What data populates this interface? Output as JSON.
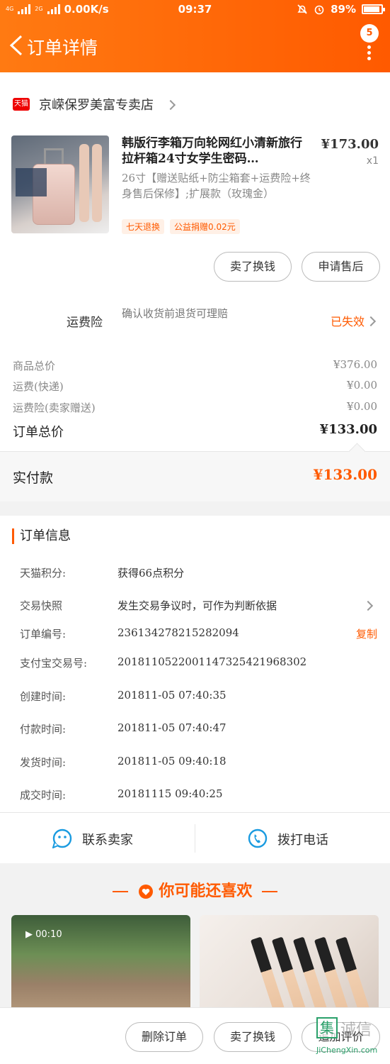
{
  "status_bar": {
    "network": "4G",
    "network2": "2G",
    "speed": "0.00K/s",
    "time": "09:37",
    "battery": "89%"
  },
  "header": {
    "title": "订单详情",
    "badge_count": "5"
  },
  "shop": {
    "badge": "天猫",
    "name": "京嵘保罗美富专卖店"
  },
  "product": {
    "title": "韩版行李箱万向轮网红小清新旅行拉杆箱24寸女学生密码…",
    "sku": "26寸【赠送贴纸+防尘箱套+运费险+终身售后保修】;扩展款（玫瑰金）",
    "tags": [
      "七天退换",
      "公益捐赠0.02元"
    ],
    "price": "¥173.00",
    "qty": "x1"
  },
  "actions": {
    "sell_for_cash": "卖了换钱",
    "after_sale": "申请售后"
  },
  "insurance": {
    "label": "运费险",
    "desc": "确认收货前退货可理赔",
    "status": "已失效"
  },
  "summary": {
    "goods_total_label": "商品总价",
    "goods_total_value": "¥376.00",
    "shipping_label": "运费(快递)",
    "shipping_value": "¥0.00",
    "insurance_label": "运费险(卖家赠送)",
    "insurance_value": "¥0.00",
    "order_total_label": "订单总价",
    "order_total_value": "¥133.00",
    "paid_label": "实付款",
    "paid_value": "¥133.00"
  },
  "order_info": {
    "heading": "订单信息",
    "rows": [
      {
        "key": "天猫积分:",
        "value": "获得66点积分"
      },
      {
        "key": "交易快照",
        "value": "发生交易争议时，可作为判断依据"
      },
      {
        "key": "订单编号:",
        "value": "236134278215282094"
      },
      {
        "key": "支付宝交易号:",
        "value": "2018110522001147325421968302"
      },
      {
        "key": "创建时间:",
        "value": "201811-05 07:40:35"
      },
      {
        "key": "付款时间:",
        "value": "201811-05 07:40:47"
      },
      {
        "key": "发货时间:",
        "value": "201811-05 09:40:18"
      },
      {
        "key": "成交时间:",
        "value": "20181115 09:40:25"
      }
    ],
    "copy_label": "复制"
  },
  "contact": {
    "seller": "联系卖家",
    "call": "拨打电话"
  },
  "recommend": {
    "title": "你可能还喜欢",
    "video_time": "00:10"
  },
  "bottom": {
    "delete": "删除订单",
    "sell": "卖了换钱",
    "review": "追加评价"
  },
  "watermark": {
    "char": "集",
    "text": "诚信",
    "url": "JiChengXin.com"
  },
  "colors": {
    "accent": "#ff5a00",
    "header_start": "#ff7a12"
  }
}
